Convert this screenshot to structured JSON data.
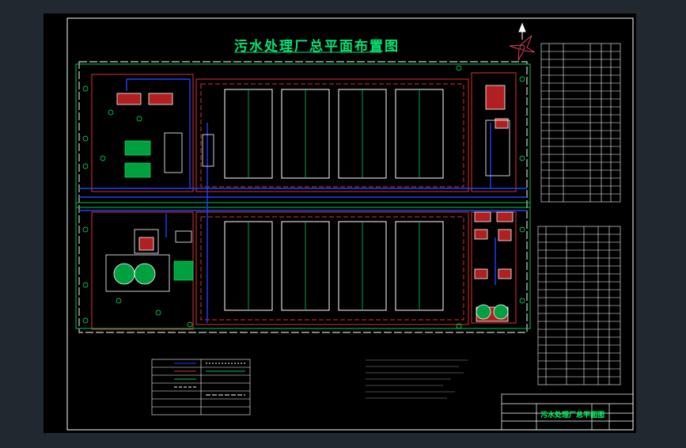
{
  "drawing": {
    "title": "污水处理厂总平面布置图",
    "titleblock_name": "污水处理厂总平面图"
  },
  "colors": {
    "background": "#212830",
    "sheet": "#000000",
    "frame": "#ffffff",
    "title": "#00e676",
    "wall": "#d0d0d0",
    "road": "#e03030",
    "pipe": "#2040ff",
    "green": "#00c853",
    "tank_fill": "#b02020"
  },
  "icons": {
    "north_arrow": "north-arrow-icon",
    "wind_rose": "wind-rose-icon",
    "tree": "tree-icon"
  }
}
